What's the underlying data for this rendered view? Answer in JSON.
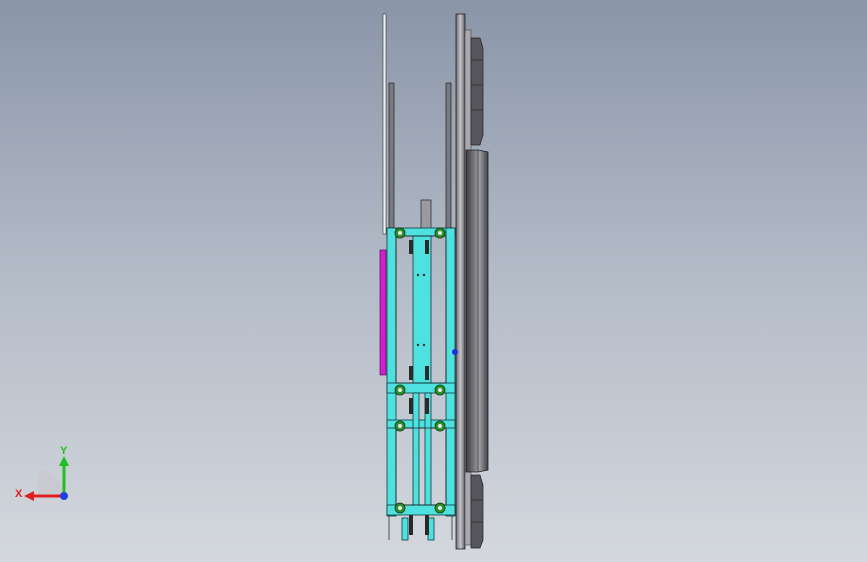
{
  "viewport": {
    "background_top": "#8a95a8",
    "background_bottom": "#d4d8de"
  },
  "model": {
    "frame_color": "#4fe0e0",
    "roller_color": "#2f8f2f",
    "plate_color": "#909094",
    "accent_color": "#d020d0"
  },
  "triad": {
    "x_label": "X",
    "y_label": "Y",
    "x_color": "#e02020",
    "y_color": "#20c020",
    "z_color": "#2040e0"
  }
}
